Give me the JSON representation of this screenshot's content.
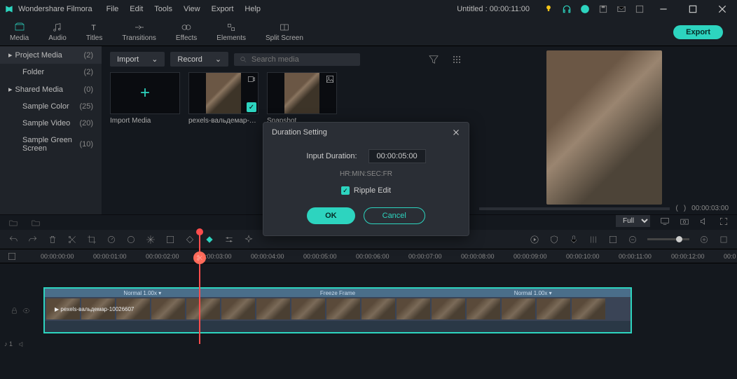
{
  "app_title": "Wondershare Filmora",
  "menu": [
    "File",
    "Edit",
    "Tools",
    "View",
    "Export",
    "Help"
  ],
  "doc_title": "Untitled : 00:00:11:00",
  "ribbon": {
    "tabs": [
      "Media",
      "Audio",
      "Titles",
      "Transitions",
      "Effects",
      "Elements",
      "Split Screen"
    ],
    "active": 0,
    "export": "Export"
  },
  "sidebar": {
    "items": [
      {
        "label": "Project Media",
        "count": "(2)",
        "type": "header"
      },
      {
        "label": "Folder",
        "count": "(2)",
        "type": "folder"
      },
      {
        "label": "Shared Media",
        "count": "(0)",
        "type": "header"
      },
      {
        "label": "Sample Color",
        "count": "(25)",
        "type": "folder"
      },
      {
        "label": "Sample Video",
        "count": "(20)",
        "type": "folder"
      },
      {
        "label": "Sample Green Screen",
        "count": "(10)",
        "type": "folder"
      }
    ]
  },
  "media": {
    "import_btn": "Import",
    "record_btn": "Record",
    "search_placeholder": "Search media",
    "items": [
      {
        "label": "Import Media",
        "type": "import"
      },
      {
        "label": "pexels-вальдемар-10026...",
        "type": "video",
        "checked": true
      },
      {
        "label": "Snapshot",
        "type": "image"
      }
    ]
  },
  "preview": {
    "time_end": "00:00:03:00",
    "fit": "Full"
  },
  "ruler_ticks": [
    "00:00:00:00",
    "00:00:01:00",
    "00:00:02:00",
    "00:00:03:00",
    "00:00:04:00",
    "00:00:05:00",
    "00:00:06:00",
    "00:00:07:00",
    "00:00:08:00",
    "00:00:09:00",
    "00:00:10:00",
    "00:00:11:00",
    "00:00:12:00",
    "00:0"
  ],
  "timeline": {
    "clip_seg1": "Normal 1.00x ▾",
    "clip_seg2": "Freeze Frame",
    "clip_seg3": "Normal 1.00x ▾",
    "clip_name": "▶ pexels-вальдемар-10026607"
  },
  "dialog": {
    "title": "Duration Setting",
    "input_label": "Input Duration:",
    "input_value": "00:00:05:00",
    "hint": "HR:MIN:SEC:FR",
    "ripple_label": "Ripple Edit",
    "ok": "OK",
    "cancel": "Cancel"
  }
}
